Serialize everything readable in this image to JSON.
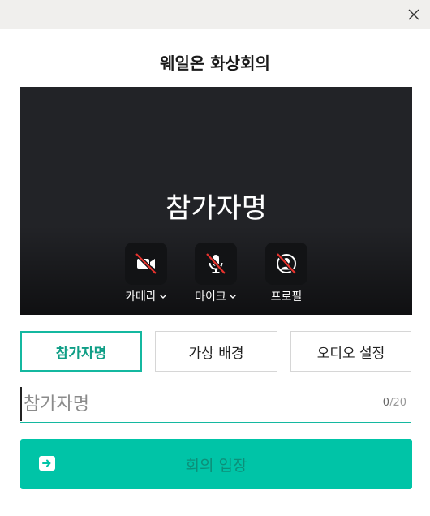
{
  "window": {
    "close_icon": "close-icon"
  },
  "dialog": {
    "title": "웨일온 화상회의"
  },
  "preview": {
    "participant_name": "참가자명",
    "controls": [
      {
        "label": "카메라",
        "icon": "video-off-icon",
        "has_dropdown": true
      },
      {
        "label": "마이크",
        "icon": "mic-off-icon",
        "has_dropdown": true
      },
      {
        "label": "프로필",
        "icon": "profile-off-icon",
        "has_dropdown": false
      }
    ]
  },
  "tabs": [
    {
      "label": "참가자명",
      "active": true
    },
    {
      "label": "가상 배경",
      "active": false
    },
    {
      "label": "오디오 설정",
      "active": false
    }
  ],
  "name_input": {
    "value": "",
    "placeholder": "참가자명",
    "count_current": "0",
    "count_max": "/20"
  },
  "join_button": {
    "label": "회의 입장",
    "icon": "enter-icon"
  },
  "colors": {
    "accent": "#14b8a0",
    "join_button": "#00c4a7",
    "preview_bg": "#222327"
  }
}
